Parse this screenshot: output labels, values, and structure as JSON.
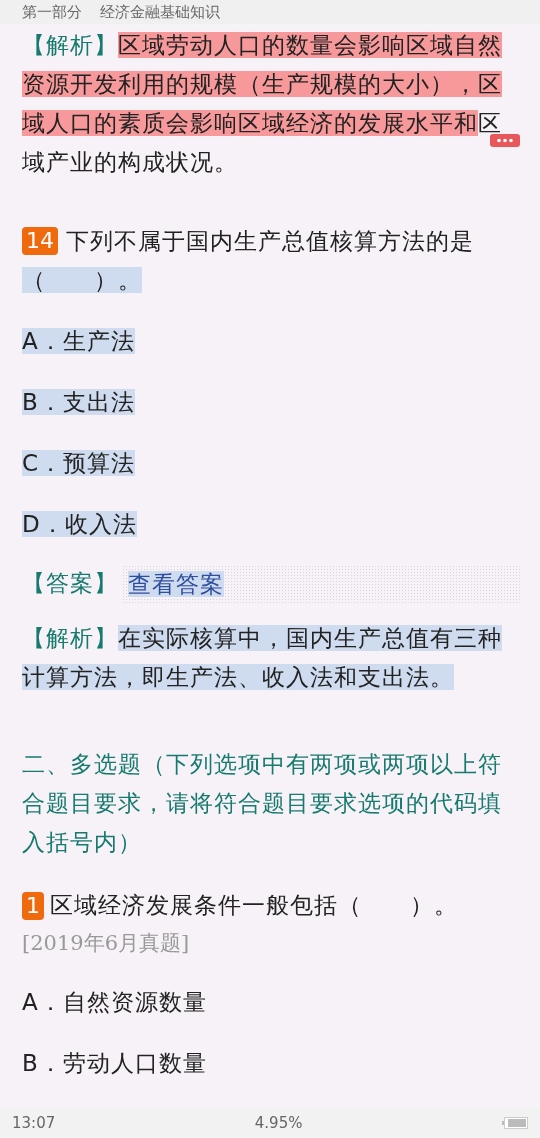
{
  "header": {
    "part": "第一部分",
    "chapter": "经济金融基础知识"
  },
  "prev_explanation": {
    "label": "【解析】",
    "segments": [
      {
        "text": "区域劳动人口的数量会影响区域自然资源开发利用的规模（生产规模的大小），区域人口的素质会影响区域经济的发展水平和",
        "highlighted": true
      },
      {
        "text": "区域产业的构成状况。",
        "highlighted": false
      }
    ]
  },
  "question_14": {
    "number": "14",
    "segments": [
      {
        "text": "下列不属于国内生产总值核算方法的是",
        "highlighted": false
      },
      {
        "text": "（　　）。",
        "highlighted": true
      }
    ],
    "options": [
      {
        "text": "A．生产法",
        "highlighted": true
      },
      {
        "text": "B．支出法",
        "highlighted": true
      },
      {
        "text": "C．预算法",
        "highlighted": true
      },
      {
        "text": "D．收入法",
        "highlighted": true
      }
    ],
    "answer": {
      "label": "【答案】",
      "link": "查看答案"
    },
    "explanation": {
      "label": "【解析】",
      "segments": [
        {
          "text": "在实际核算中，国内生产总值有三种计算方法，即生产法、收入法和支出法。",
          "highlighted": true
        }
      ]
    }
  },
  "section_heading": "二、多选题（下列选项中有两项或两项以上符合题目要求，请将符合题目要求选项的代码填入括号内）",
  "question_1": {
    "number": "1",
    "segments": [
      {
        "text": "区域经济发展条件一般包括（　　）。",
        "highlighted": false
      }
    ],
    "source": "[2019年6月真题]",
    "options": [
      {
        "text": "A．自然资源数量",
        "highlighted": false
      },
      {
        "text": "B．劳动人口数量",
        "highlighted": false
      }
    ]
  },
  "status_bar": {
    "time": "13:07",
    "percent": "4.95%"
  }
}
